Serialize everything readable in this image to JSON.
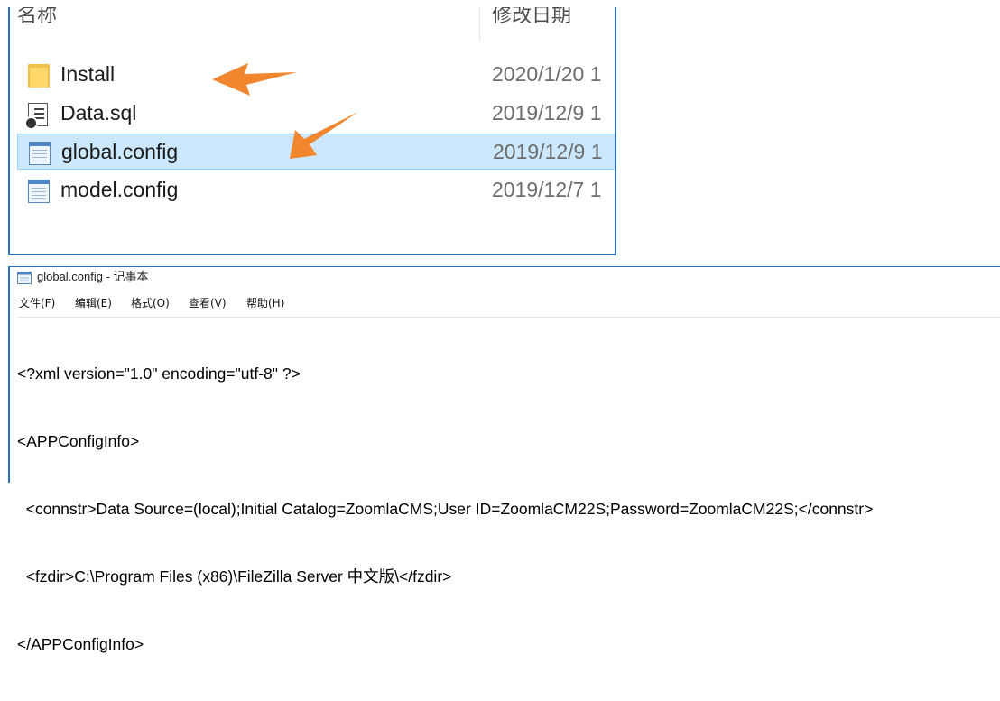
{
  "explorer": {
    "columns": {
      "name": "名称",
      "date": "修改日期"
    },
    "files": [
      {
        "name": "Install",
        "date": "2020/1/20 1",
        "icon": "folder-icon",
        "selected": false
      },
      {
        "name": "Data.sql",
        "date": "2019/12/9 1",
        "icon": "sql-file-icon",
        "selected": false
      },
      {
        "name": "global.config",
        "date": "2019/12/9 1",
        "icon": "notepad-file-icon",
        "selected": true
      },
      {
        "name": "model.config",
        "date": "2019/12/7 1",
        "icon": "notepad-file-icon",
        "selected": false
      }
    ],
    "selection_color": "#cce8ff",
    "border_color": "#2a6fbf",
    "arrow_color": "#f0862d"
  },
  "notepad": {
    "title": "global.config - 记事本",
    "menu": [
      "文件(F)",
      "编辑(E)",
      "格式(O)",
      "查看(V)",
      "帮助(H)"
    ],
    "lines": [
      "<?xml version=\"1.0\" encoding=\"utf-8\" ?>",
      "<APPConfigInfo>",
      "  <connstr>Data Source=(local);Initial Catalog=ZoomlaCMS;User ID=ZoomlaCM22S;Password=ZoomlaCM22S;</connstr>",
      "  <fzdir>C:\\Program Files (x86)\\FileZilla Server 中文版\\</fzdir>",
      "</APPConfigInfo>"
    ]
  }
}
